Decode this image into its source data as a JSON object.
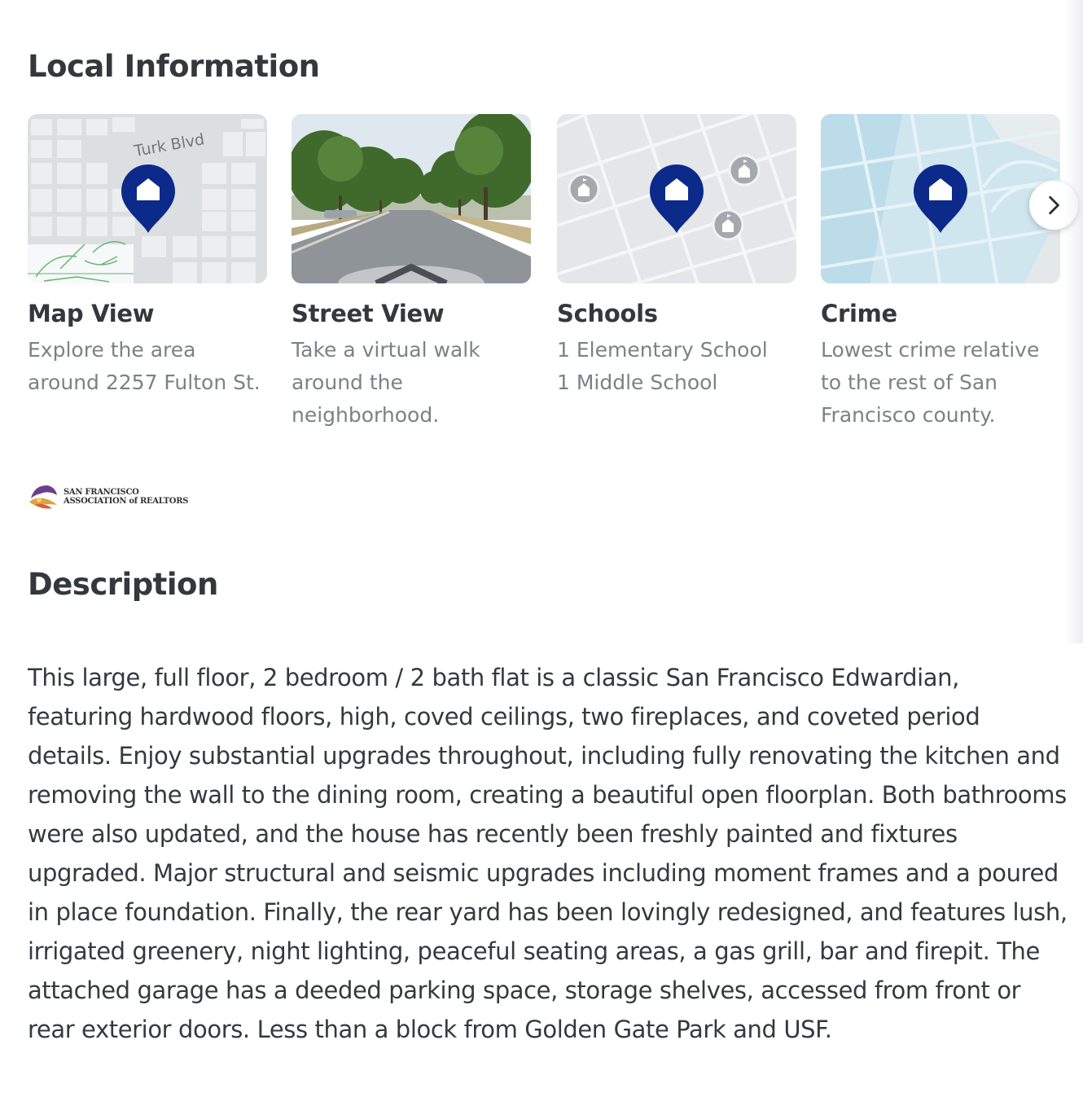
{
  "local_info": {
    "title": "Local Information",
    "cards": [
      {
        "title": "Map View",
        "lines": [
          "Explore the area",
          "around 2257 Fulton St."
        ],
        "map_label": "Turk Blvd",
        "icon": "home-pin-icon"
      },
      {
        "title": "Street View",
        "lines": [
          "Take a virtual walk",
          "around the",
          "neighborhood."
        ],
        "icon": "street-view-photo"
      },
      {
        "title": "Schools",
        "lines": [
          "1 Elementary School",
          "1 Middle School"
        ],
        "icon": "school-icon"
      },
      {
        "title": "Crime",
        "lines": [
          "Lowest crime relative",
          "to the rest of San",
          "Francisco county."
        ],
        "icon": "home-pin-icon"
      }
    ],
    "next_icon": "chevron-right-icon"
  },
  "logo": {
    "line1": "SAN FRANCISCO",
    "line2": "ASSOCIATION of REALTORS"
  },
  "description": {
    "title": "Description",
    "body": "This large, full floor, 2 bedroom / 2 bath flat is a classic San Francisco Edwardian, featuring hardwood floors, high, coved ceilings, two fireplaces, and coveted period details. Enjoy substantial upgrades throughout, including fully renovating the kitchen and removing the wall to the dining room, creating a beautiful open floorplan. Both bathrooms were also updated, and the house has recently been freshly painted and fixtures upgraded. Major structural and seismic upgrades including moment frames and a poured in place foundation. Finally, the rear yard has been lovingly redesigned, and features lush, irrigated greenery, night lighting, peaceful seating areas, a gas grill, bar and firepit. The attached garage has a deeded parking space, storage shelves, accessed from front or rear exterior doors. Less than a block from Golden Gate Park and USF."
  },
  "colors": {
    "pin": "#0b2a8a",
    "map_bg": "#e4e6e9",
    "crime_bg": "#cfe6ef",
    "muted_text": "#7a8288",
    "heading": "#33383c"
  }
}
